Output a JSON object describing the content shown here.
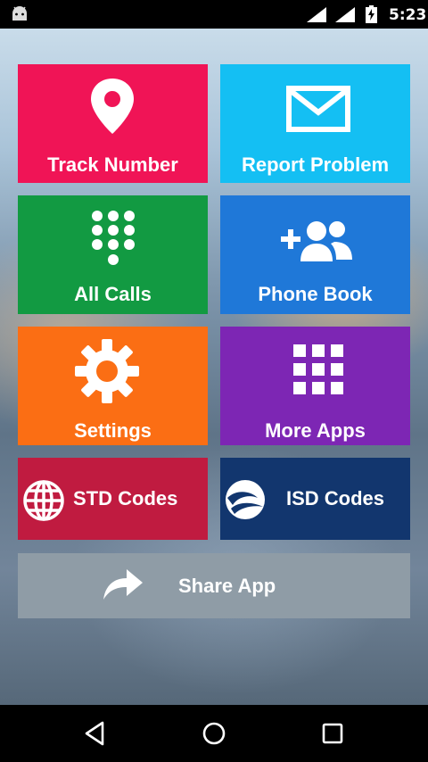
{
  "status_bar": {
    "time": "5:23",
    "icons": [
      "android-notification-icon",
      "signal-icon",
      "signal-icon",
      "battery-charging-icon"
    ]
  },
  "tiles": {
    "track_number": {
      "label": "Track Number",
      "icon": "location-pin-icon",
      "color": "#f01456"
    },
    "report_problem": {
      "label": "Report Problem",
      "icon": "mail-icon",
      "color": "#14bff3"
    },
    "all_calls": {
      "label": "All Calls",
      "icon": "dialpad-icon",
      "color": "#129a42"
    },
    "phone_book": {
      "label": "Phone Book",
      "icon": "add-contacts-icon",
      "color": "#1f78d8"
    },
    "settings": {
      "label": "Settings",
      "icon": "gear-icon",
      "color": "#fb6e14"
    },
    "more_apps": {
      "label": "More Apps",
      "icon": "apps-grid-icon",
      "color": "#7d26b4"
    },
    "std_codes": {
      "label": "STD Codes",
      "icon": "globe-icon",
      "color": "#c01b40"
    },
    "isd_codes": {
      "label": "ISD Codes",
      "icon": "earth-icon",
      "color": "#12366e"
    },
    "share_app": {
      "label": "Share App",
      "icon": "share-arrow-icon",
      "color": "#8f9ca6"
    }
  },
  "nav_bar": {
    "buttons": [
      "back-icon",
      "home-icon",
      "recents-icon"
    ]
  }
}
